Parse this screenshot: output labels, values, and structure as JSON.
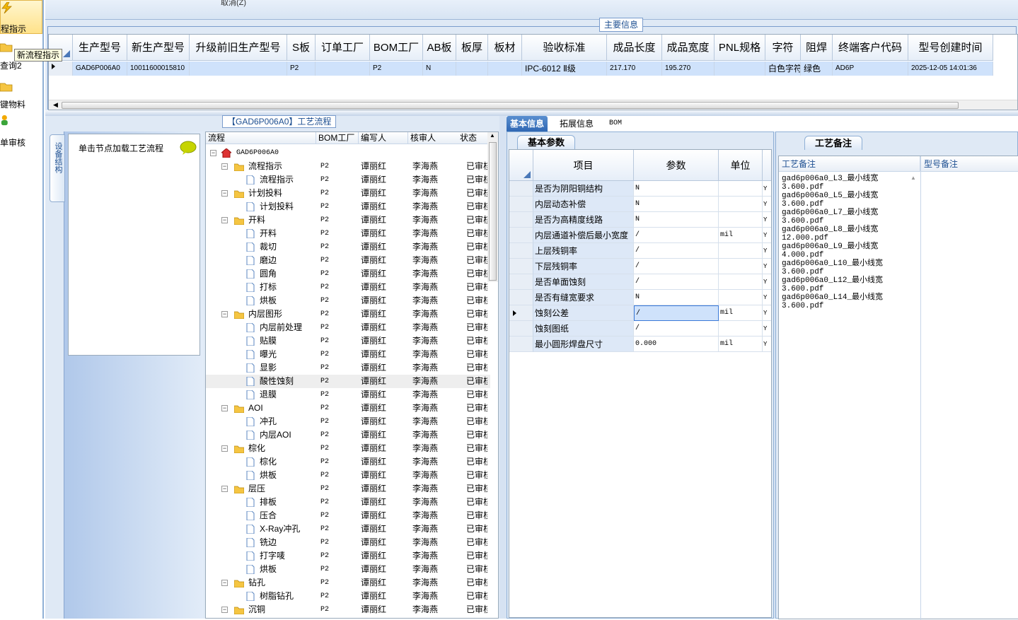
{
  "sidebar": {
    "items": [
      {
        "label": "程指示",
        "icon": "lightning-icon"
      },
      {
        "label": "查询2",
        "icon": "folder-icon"
      },
      {
        "label": "键物料",
        "icon": "folder-icon"
      },
      {
        "label": "单审核",
        "icon": "user-icon"
      }
    ],
    "tooltip": "新流程指示"
  },
  "toolbar": {
    "cancel_label": "取消(Z)"
  },
  "main_info": {
    "title": "主要信息",
    "columns": [
      "生产型号",
      "新生产型号",
      "升级前旧生产型号",
      "S板",
      "订单工厂",
      "BOM工厂",
      "AB板",
      "板厚",
      "板材",
      "验收标准",
      "成品长度",
      "成品宽度",
      "PNL规格",
      "字符",
      "阻焊",
      "终端客户代码",
      "型号创建时间"
    ],
    "row": [
      "GAD6P006A0",
      "10011600015810",
      "",
      "P2",
      "",
      "P2",
      "N",
      "",
      "",
      "IPC-6012 Ⅱ级",
      "217.170",
      "195.270",
      "",
      "白色字符",
      "绿色",
      "AD6P",
      "2025-12-05 14:01:36"
    ]
  },
  "process_flow": {
    "title": "【GAD6P006A0】工艺流程",
    "vertical_tab": "设备结构",
    "node_hint": "单击节点加载工艺流程",
    "columns": [
      "流程",
      "BOM工厂",
      "编写人",
      "核审人",
      "状态"
    ],
    "root": "GAD6P006A0",
    "rows": [
      {
        "name": "流程指示",
        "level": 1,
        "folder": true
      },
      {
        "name": "流程指示",
        "level": 2,
        "folder": false
      },
      {
        "name": "计划投料",
        "level": 1,
        "folder": true
      },
      {
        "name": "计划投料",
        "level": 2,
        "folder": false
      },
      {
        "name": "开料",
        "level": 1,
        "folder": true
      },
      {
        "name": "开料",
        "level": 2,
        "folder": false
      },
      {
        "name": "裁切",
        "level": 2,
        "folder": false
      },
      {
        "name": "磨边",
        "level": 2,
        "folder": false
      },
      {
        "name": "圆角",
        "level": 2,
        "folder": false
      },
      {
        "name": "打标",
        "level": 2,
        "folder": false
      },
      {
        "name": "烘板",
        "level": 2,
        "folder": false
      },
      {
        "name": "内层图形",
        "level": 1,
        "folder": true
      },
      {
        "name": "内层前处理",
        "level": 2,
        "folder": false
      },
      {
        "name": "贴膜",
        "level": 2,
        "folder": false
      },
      {
        "name": "曝光",
        "level": 2,
        "folder": false
      },
      {
        "name": "显影",
        "level": 2,
        "folder": false
      },
      {
        "name": "酸性蚀刻",
        "level": 2,
        "folder": false,
        "selected": true
      },
      {
        "name": "退膜",
        "level": 2,
        "folder": false
      },
      {
        "name": "AOI",
        "level": 1,
        "folder": true
      },
      {
        "name": "冲孔",
        "level": 2,
        "folder": false
      },
      {
        "name": "内层AOI",
        "level": 2,
        "folder": false
      },
      {
        "name": "棕化",
        "level": 1,
        "folder": true
      },
      {
        "name": "棕化",
        "level": 2,
        "folder": false
      },
      {
        "name": "烘板",
        "level": 2,
        "folder": false
      },
      {
        "name": "层压",
        "level": 1,
        "folder": true
      },
      {
        "name": "排板",
        "level": 2,
        "folder": false
      },
      {
        "name": "压合",
        "level": 2,
        "folder": false
      },
      {
        "name": "X-Ray冲孔",
        "level": 2,
        "folder": false
      },
      {
        "name": "铣边",
        "level": 2,
        "folder": false
      },
      {
        "name": "打字唛",
        "level": 2,
        "folder": false
      },
      {
        "name": "烘板",
        "level": 2,
        "folder": false
      },
      {
        "name": "钻孔",
        "level": 1,
        "folder": true
      },
      {
        "name": "树脂钻孔",
        "level": 2,
        "folder": false
      },
      {
        "name": "沉铜",
        "level": 1,
        "folder": true
      }
    ],
    "bom_factory": "P2",
    "writer": "谭丽红",
    "reviewer": "李海燕",
    "status": "已审核"
  },
  "tabs": [
    "基本信息",
    "拓展信息",
    "BOM"
  ],
  "basic_params": {
    "title": "基本参数",
    "columns": [
      "项目",
      "参数",
      "单位"
    ],
    "rows": [
      {
        "item": "是否为阴阳铜结构",
        "value": "N",
        "unit": "",
        "flag": "Y"
      },
      {
        "item": "内层动态补偿",
        "value": "N",
        "unit": "",
        "flag": "Y"
      },
      {
        "item": "是否为高精度线路",
        "value": "N",
        "unit": "",
        "flag": "Y"
      },
      {
        "item": "内层通道补偿后最小宽度",
        "value": "/",
        "unit": "mil",
        "flag": "Y"
      },
      {
        "item": "上层残铜率",
        "value": "/",
        "unit": "",
        "flag": "Y"
      },
      {
        "item": "下层残铜率",
        "value": "/",
        "unit": "",
        "flag": "Y"
      },
      {
        "item": "是否单面蚀刻",
        "value": "/",
        "unit": "",
        "flag": "Y"
      },
      {
        "item": "是否有缝宽要求",
        "value": "N",
        "unit": "",
        "flag": "Y"
      },
      {
        "item": "蚀刻公差",
        "value": "/",
        "unit": "mil",
        "flag": "Y",
        "selected": true
      },
      {
        "item": "蚀刻图纸",
        "value": "/",
        "unit": "",
        "flag": "Y"
      },
      {
        "item": "最小圆形焊盘尺寸",
        "value": "0.000",
        "unit": "mil",
        "flag": "Y"
      }
    ]
  },
  "process_notes": {
    "title": "工艺备注",
    "col1": "工艺备注",
    "col2": "型号备注",
    "text": "gad6p006a0_L3_最小线宽\n3.600.pdf\ngad6p006a0_L5_最小线宽\n3.600.pdf\ngad6p006a0_L7_最小线宽\n3.600.pdf\ngad6p006a0_L8_最小线宽\n12.000.pdf\ngad6p006a0_L9_最小线宽\n4.000.pdf\ngad6p006a0_L10_最小线宽\n3.600.pdf\ngad6p006a0_L12_最小线宽\n3.600.pdf\ngad6p006a0_L14_最小线宽\n3.600.pdf"
  },
  "colors": {
    "accent": "#2f67b3",
    "selection": "#cfe2fb",
    "panel": "#dfe9f5"
  }
}
